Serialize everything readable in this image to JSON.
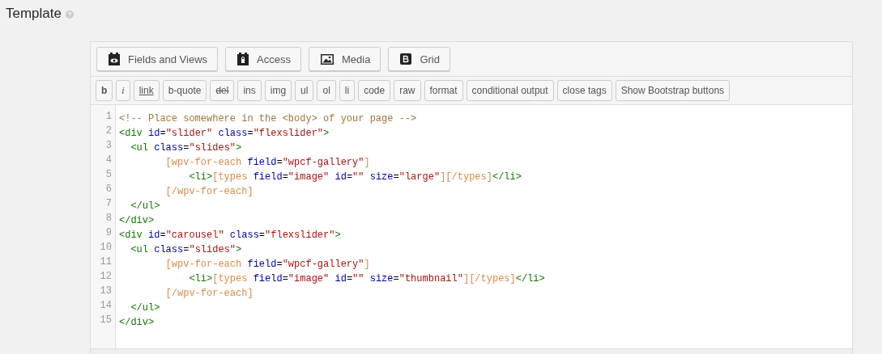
{
  "section_title": "Template",
  "main_toolbar": [
    {
      "label": "Fields and Views",
      "kind": "fields"
    },
    {
      "label": "Access",
      "kind": "access"
    },
    {
      "label": "Media",
      "kind": "media"
    },
    {
      "label": "Grid",
      "kind": "grid"
    }
  ],
  "quicktags": [
    {
      "label": "b",
      "kind": "bold"
    },
    {
      "label": "i",
      "kind": "italic"
    },
    {
      "label": "link",
      "kind": "link"
    },
    {
      "label": "b-quote",
      "kind": "plain"
    },
    {
      "label": "del",
      "kind": "strike"
    },
    {
      "label": "ins",
      "kind": "plain"
    },
    {
      "label": "img",
      "kind": "plain"
    },
    {
      "label": "ul",
      "kind": "plain"
    },
    {
      "label": "ol",
      "kind": "plain"
    },
    {
      "label": "li",
      "kind": "plain"
    },
    {
      "label": "code",
      "kind": "plain"
    },
    {
      "label": "raw",
      "kind": "plain"
    },
    {
      "label": "format",
      "kind": "plain"
    },
    {
      "label": "conditional output",
      "kind": "plain"
    },
    {
      "label": "close tags",
      "kind": "plain"
    },
    {
      "label": "Show Bootstrap buttons",
      "kind": "plain"
    }
  ],
  "code_lines": [
    {
      "number": "1",
      "tokens": [
        {
          "kind": "comment",
          "text": "<!-- Place somewhere in the <body> of your page -->"
        }
      ]
    },
    {
      "number": "2",
      "tokens": [
        {
          "kind": "tag",
          "text": "<div"
        },
        {
          "kind": "attr",
          "text": " id"
        },
        {
          "kind": "plain",
          "text": "="
        },
        {
          "kind": "string",
          "text": "\"slider\""
        },
        {
          "kind": "attr",
          "text": " class"
        },
        {
          "kind": "plain",
          "text": "="
        },
        {
          "kind": "string",
          "text": "\"flexslider\""
        },
        {
          "kind": "tag",
          "text": ">"
        }
      ]
    },
    {
      "number": "3",
      "tokens": [
        {
          "kind": "tag",
          "text": "  <ul"
        },
        {
          "kind": "attr",
          "text": " class"
        },
        {
          "kind": "plain",
          "text": "="
        },
        {
          "kind": "string",
          "text": "\"slides\""
        },
        {
          "kind": "tag",
          "text": ">"
        }
      ]
    },
    {
      "number": "4",
      "tokens": [
        {
          "kind": "shortcode",
          "text": "        [wpv-for-each"
        },
        {
          "kind": "attr",
          "text": " field"
        },
        {
          "kind": "plain",
          "text": "="
        },
        {
          "kind": "string",
          "text": "\"wpcf-gallery\""
        },
        {
          "kind": "shortcode",
          "text": "]"
        }
      ]
    },
    {
      "number": "5",
      "tokens": [
        {
          "kind": "tag",
          "text": "            <li>"
        },
        {
          "kind": "shortcode",
          "text": "[types"
        },
        {
          "kind": "attr",
          "text": " field"
        },
        {
          "kind": "plain",
          "text": "="
        },
        {
          "kind": "string",
          "text": "\"image\""
        },
        {
          "kind": "attr",
          "text": " id"
        },
        {
          "kind": "plain",
          "text": "="
        },
        {
          "kind": "string",
          "text": "\"\""
        },
        {
          "kind": "attr",
          "text": " size"
        },
        {
          "kind": "plain",
          "text": "="
        },
        {
          "kind": "string",
          "text": "\"large\""
        },
        {
          "kind": "shortcode",
          "text": "][/types]"
        },
        {
          "kind": "tag",
          "text": "</li>"
        }
      ]
    },
    {
      "number": "6",
      "tokens": [
        {
          "kind": "shortcode",
          "text": "        [/wpv-for-each]"
        }
      ]
    },
    {
      "number": "7",
      "tokens": [
        {
          "kind": "tag",
          "text": "  </ul>"
        }
      ]
    },
    {
      "number": "8",
      "tokens": [
        {
          "kind": "tag",
          "text": "</div>"
        }
      ]
    },
    {
      "number": "9",
      "tokens": [
        {
          "kind": "tag",
          "text": "<div"
        },
        {
          "kind": "attr",
          "text": " id"
        },
        {
          "kind": "plain",
          "text": "="
        },
        {
          "kind": "string",
          "text": "\"carousel\""
        },
        {
          "kind": "attr",
          "text": " class"
        },
        {
          "kind": "plain",
          "text": "="
        },
        {
          "kind": "string",
          "text": "\"flexslider\""
        },
        {
          "kind": "tag",
          "text": ">"
        }
      ]
    },
    {
      "number": "10",
      "tokens": [
        {
          "kind": "tag",
          "text": "  <ul"
        },
        {
          "kind": "attr",
          "text": " class"
        },
        {
          "kind": "plain",
          "text": "="
        },
        {
          "kind": "string",
          "text": "\"slides\""
        },
        {
          "kind": "tag",
          "text": ">"
        }
      ]
    },
    {
      "number": "11",
      "tokens": [
        {
          "kind": "shortcode",
          "text": "        [wpv-for-each"
        },
        {
          "kind": "attr",
          "text": " field"
        },
        {
          "kind": "plain",
          "text": "="
        },
        {
          "kind": "string",
          "text": "\"wpcf-gallery\""
        },
        {
          "kind": "shortcode",
          "text": "]"
        }
      ]
    },
    {
      "number": "12",
      "tokens": [
        {
          "kind": "tag",
          "text": "            <li>"
        },
        {
          "kind": "shortcode",
          "text": "[types"
        },
        {
          "kind": "attr",
          "text": " field"
        },
        {
          "kind": "plain",
          "text": "="
        },
        {
          "kind": "string",
          "text": "\"image\""
        },
        {
          "kind": "attr",
          "text": " id"
        },
        {
          "kind": "plain",
          "text": "="
        },
        {
          "kind": "string",
          "text": "\"\""
        },
        {
          "kind": "attr",
          "text": " size"
        },
        {
          "kind": "plain",
          "text": "="
        },
        {
          "kind": "string",
          "text": "\"thumbnail\""
        },
        {
          "kind": "shortcode",
          "text": "][/types]"
        },
        {
          "kind": "tag",
          "text": "</li>"
        }
      ]
    },
    {
      "number": "13",
      "tokens": [
        {
          "kind": "shortcode",
          "text": "        [/wpv-for-each]"
        }
      ]
    },
    {
      "number": "14",
      "tokens": [
        {
          "kind": "tag",
          "text": "  </ul>"
        }
      ]
    },
    {
      "number": "15",
      "tokens": [
        {
          "kind": "tag",
          "text": "</div>"
        }
      ]
    }
  ]
}
